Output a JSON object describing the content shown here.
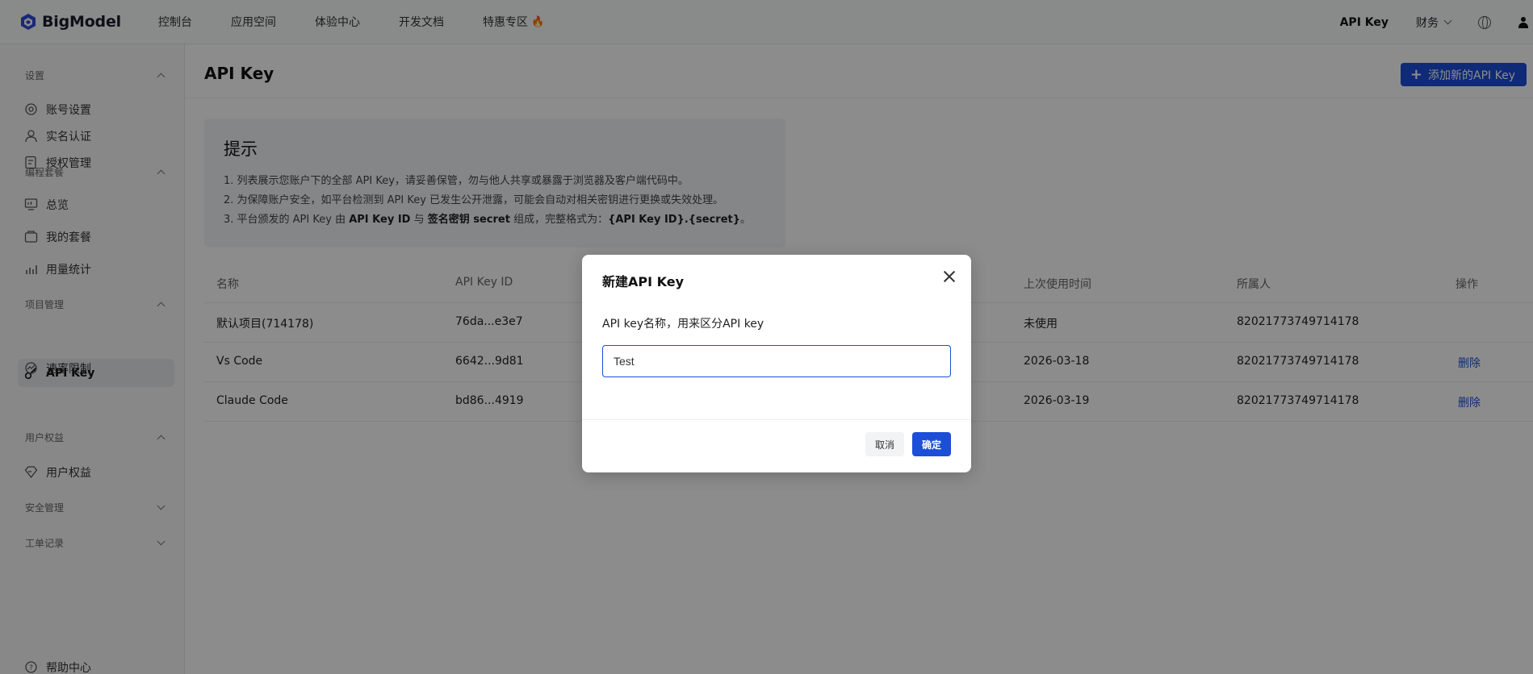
{
  "brand": {
    "name": "BigModel",
    "accent": "#1d4ed8"
  },
  "topnav": {
    "links": [
      "控制台",
      "应用空间",
      "体验中心",
      "开发文档",
      "特惠专区"
    ],
    "hot_icon": "fire-icon",
    "right": {
      "api_key": "API Key",
      "finance": "财务"
    }
  },
  "sidebar": {
    "groups": [
      {
        "title": "设置",
        "items": [
          "账号设置",
          "实名认证",
          "授权管理"
        ]
      },
      {
        "title": "编程套餐",
        "items": [
          "总览",
          "我的套餐",
          "用量统计"
        ]
      },
      {
        "title": "项目管理",
        "items": [
          "API Key",
          "速率限制"
        ]
      },
      {
        "title": "用户权益",
        "items": [
          "用户权益"
        ]
      },
      {
        "title": "安全管理",
        "items": []
      },
      {
        "title": "工单记录",
        "items": []
      }
    ],
    "help": "帮助中心"
  },
  "main": {
    "title": "API Key",
    "add_button": "添加新的API Key",
    "tip": {
      "title": "提示",
      "line1": "1. 列表展示您账户下的全部 API Key，请妥善保管，勿与他人共享或暴露于浏览器及客户端代码中。",
      "line2": "2. 为保障账户安全，如平台检测到 API Key 已发生公开泄露，可能会自动对相关密钥进行更换或失效处理。",
      "line3_pre": "3. 平台颁发的 API Key 由 ",
      "line3_b1": "API Key ID",
      "line3_mid1": " 与 ",
      "line3_b2": "签名密钥 secret",
      "line3_mid2": " 组成，完整格式为：",
      "line3_b3": "{API Key ID}.{secret}",
      "line3_end": "。"
    },
    "table": {
      "headers": {
        "name": "名称",
        "id": "API Key ID",
        "last_used": "上次使用时间",
        "owner": "所属人",
        "actions": "操作"
      },
      "rows": [
        {
          "name": "默认项目(714178)",
          "id": "76da...e3e7",
          "last_used": "未使用",
          "owner": "82021773749714178",
          "action": ""
        },
        {
          "name": "Vs Code",
          "id": "6642...9d81",
          "last_used": "2026-03-18",
          "owner": "82021773749714178",
          "action": "删除"
        },
        {
          "name": "Claude Code",
          "id": "bd86...4919",
          "last_used": "2026-03-19",
          "owner": "82021773749714178",
          "action": "删除"
        }
      ]
    }
  },
  "modal": {
    "title": "新建API Key",
    "label": "API key名称，用来区分API key",
    "value": "Test",
    "cancel": "取消",
    "confirm": "确定"
  }
}
